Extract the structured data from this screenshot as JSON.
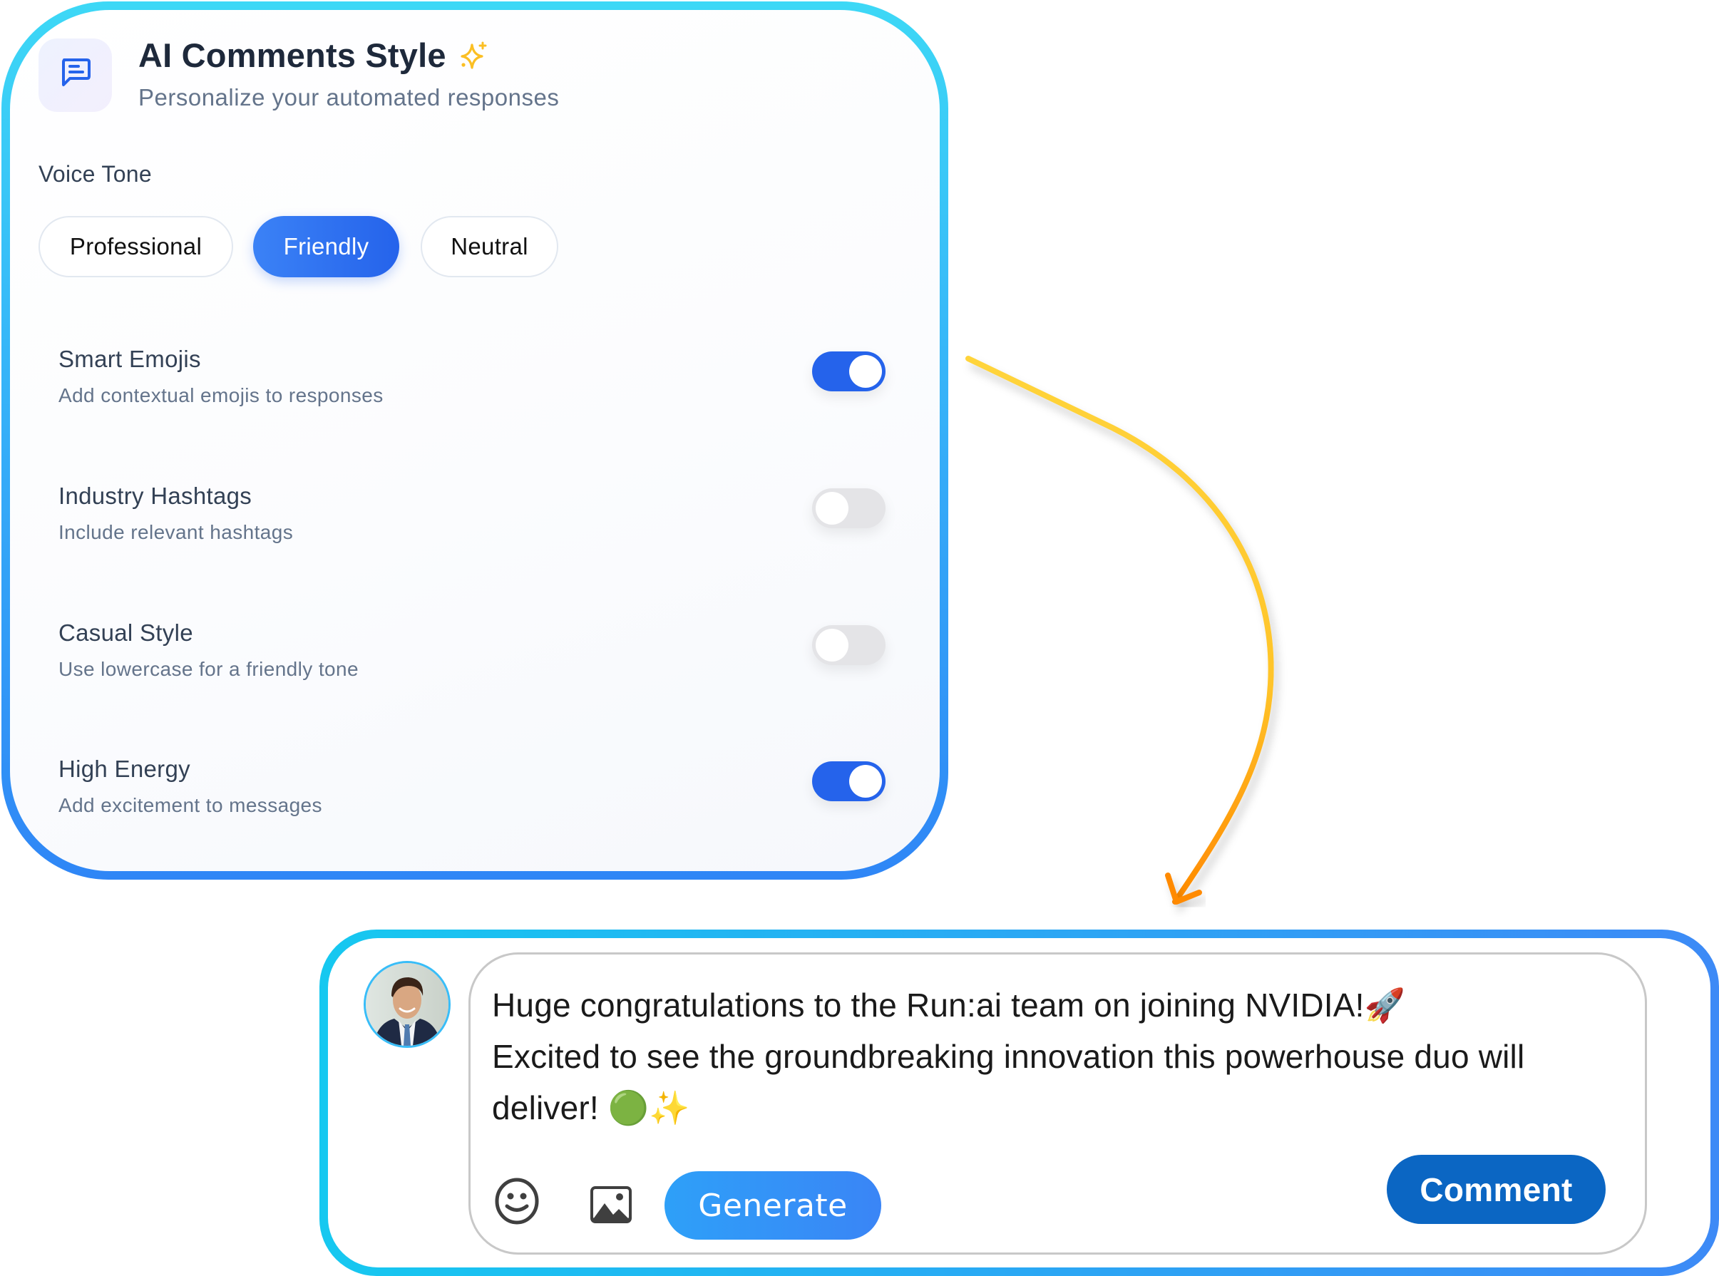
{
  "settings_panel": {
    "title": "AI Comments Style",
    "title_icon": "sparkles-icon",
    "header_icon": "chat-bubble-icon",
    "subtitle": "Personalize your automated responses",
    "voice_tone": {
      "label": "Voice Tone",
      "options": [
        {
          "label": "Professional",
          "selected": false
        },
        {
          "label": "Friendly",
          "selected": true
        },
        {
          "label": "Neutral",
          "selected": false
        }
      ]
    },
    "toggles": [
      {
        "label": "Smart Emojis",
        "description": "Add contextual emojis to responses",
        "enabled": true
      },
      {
        "label": "Industry Hashtags",
        "description": "Include relevant hashtags",
        "enabled": false
      },
      {
        "label": "Casual Style",
        "description": "Use lowercase for a friendly tone",
        "enabled": false
      },
      {
        "label": "High Energy",
        "description": "Add excitement to messages",
        "enabled": true
      }
    ]
  },
  "comment_box": {
    "avatar": "user-avatar",
    "text": "Huge congratulations to the Run:ai team on joining NVIDIA!🚀\nExcited to see the groundbreaking innovation this powerhouse duo will deliver! 🟢✨",
    "emoji_icon": "smiley-icon",
    "image_icon": "image-icon",
    "generate_label": "Generate",
    "comment_label": "Comment"
  },
  "colors": {
    "accent": "#2563eb",
    "comment_button": "#0b66c3",
    "arrow_start": "#ffd43b",
    "arrow_end": "#ff8a00",
    "sparkle": "#fbbf24"
  }
}
